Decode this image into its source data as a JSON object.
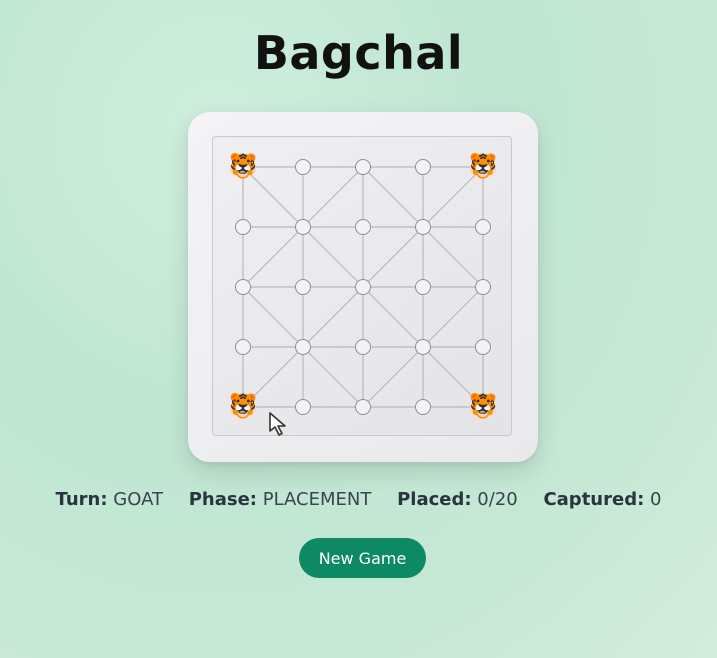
{
  "title": "Bagchal",
  "status": {
    "turn_label": "Turn:",
    "turn_value": "GOAT",
    "phase_label": "Phase:",
    "phase_value": "PLACEMENT",
    "placed_label": "Placed:",
    "placed_value": "0/20",
    "captured_label": "Captured:",
    "captured_value": "0"
  },
  "new_game_label": "New Game",
  "board": {
    "size": 5,
    "pieces": [
      {
        "row": 0,
        "col": 0,
        "type": "tiger",
        "glyph": "🐯"
      },
      {
        "row": 0,
        "col": 4,
        "type": "tiger",
        "glyph": "🐯"
      },
      {
        "row": 4,
        "col": 0,
        "type": "tiger",
        "glyph": "🐯"
      },
      {
        "row": 4,
        "col": 4,
        "type": "tiger",
        "glyph": "🐯"
      }
    ]
  }
}
